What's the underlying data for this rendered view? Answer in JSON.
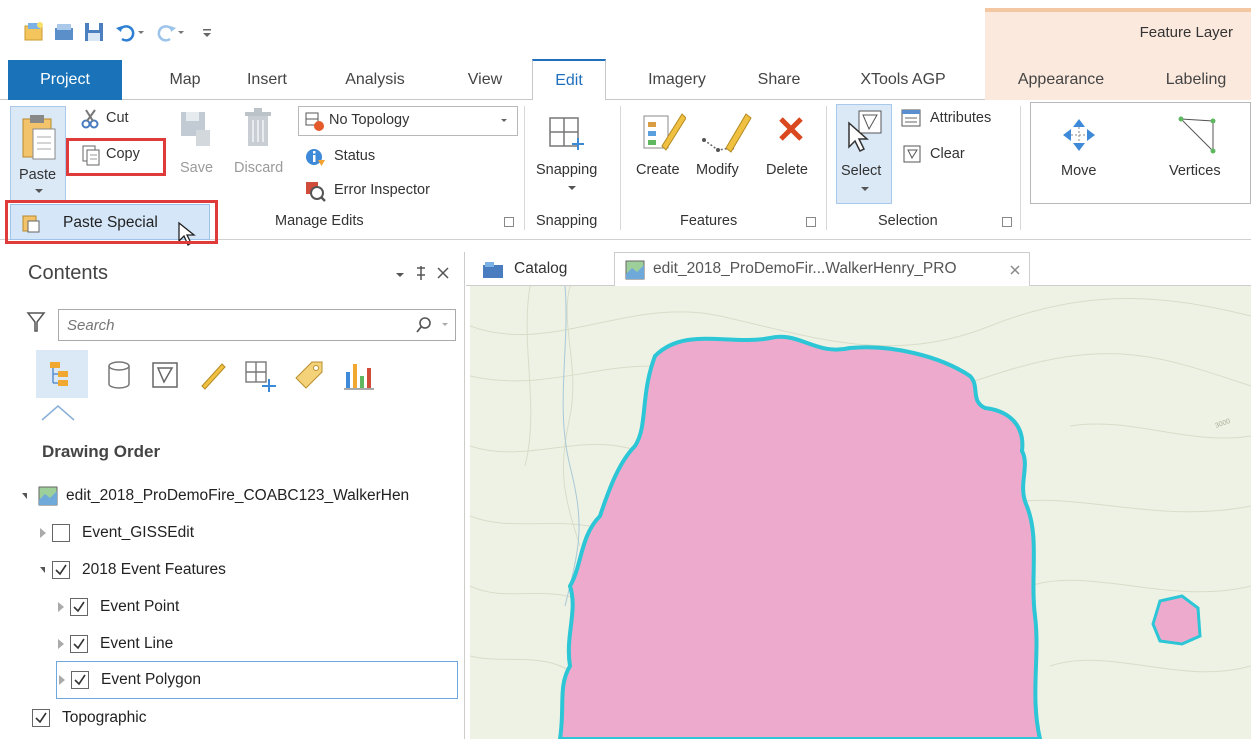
{
  "quick_access": {
    "icons": [
      "new-project-icon",
      "open-project-icon",
      "save-project-icon",
      "undo-icon",
      "redo-icon",
      "customize-icon"
    ]
  },
  "context_tab_group": "Feature Layer",
  "tabs": [
    {
      "label": "Project"
    },
    {
      "label": "Map"
    },
    {
      "label": "Insert"
    },
    {
      "label": "Analysis"
    },
    {
      "label": "View"
    },
    {
      "label": "Edit"
    },
    {
      "label": "Imagery"
    },
    {
      "label": "Share"
    },
    {
      "label": "XTools AGP"
    },
    {
      "label": "Appearance"
    },
    {
      "label": "Labeling"
    }
  ],
  "ribbon": {
    "clipboard": {
      "paste": "Paste",
      "cut": "Cut",
      "copy": "Copy"
    },
    "manage_edits": {
      "save": "Save",
      "discard": "Discard",
      "topology_value": "No Topology",
      "status": "Status",
      "error_inspector": "Error Inspector",
      "title": "Manage Edits"
    },
    "snapping": {
      "button": "Snapping",
      "title": "Snapping"
    },
    "features": {
      "create": "Create",
      "modify": "Modify",
      "delete": "Delete",
      "title": "Features"
    },
    "selection": {
      "select": "Select",
      "attributes": "Attributes",
      "clear": "Clear",
      "title": "Selection"
    },
    "tools": {
      "move": "Move",
      "vertices": "Vertices"
    }
  },
  "paste_menu": {
    "paste_special": "Paste Special"
  },
  "contents": {
    "title": "Contents",
    "search_placeholder": "Search",
    "section": "Drawing Order",
    "map_name": "edit_2018_ProDemoFire_COABC123_WalkerHen",
    "layers": [
      {
        "label": "Event_GISSEdit",
        "checked": false
      },
      {
        "label": "2018 Event Features",
        "checked": true
      },
      {
        "label": "Event Point",
        "checked": true
      },
      {
        "label": "Event Line",
        "checked": true
      },
      {
        "label": "Event Polygon",
        "checked": true
      },
      {
        "label": "Topographic",
        "checked": true
      }
    ]
  },
  "view_tabs": {
    "catalog": "Catalog",
    "map": "edit_2018_ProDemoFir...WalkerHenry_PRO"
  },
  "colors": {
    "accent": "#1f6fbd",
    "highlight_red": "#e03b3b",
    "polygon_fill": "#eeaacc",
    "polygon_outline": "#2cc6d6",
    "map_background": "#eef2e4"
  }
}
